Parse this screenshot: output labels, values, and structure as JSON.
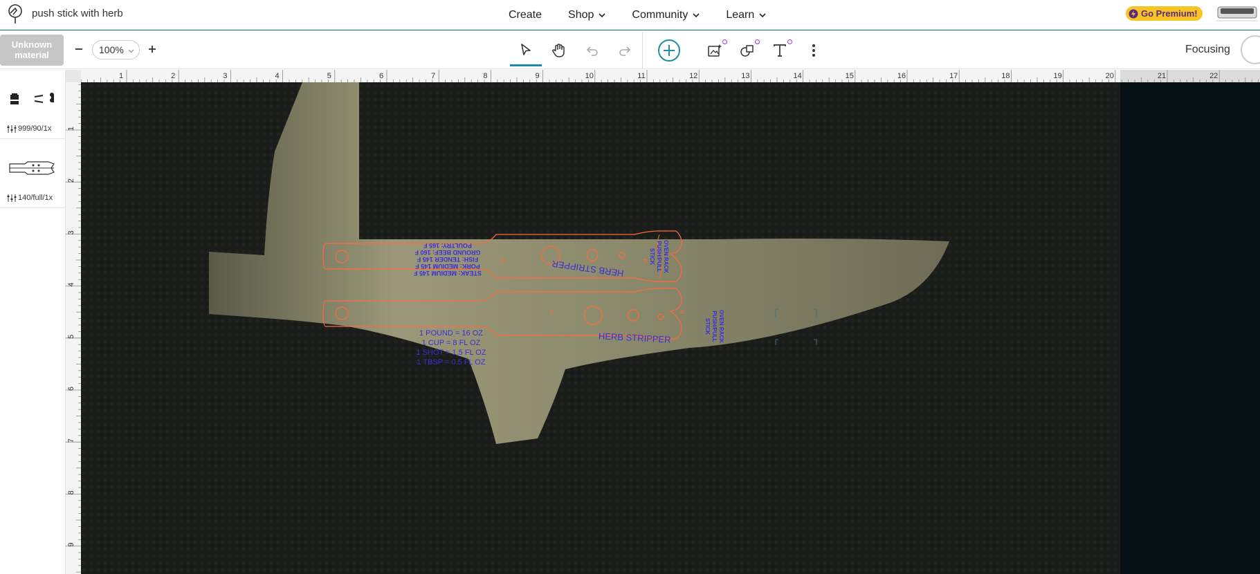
{
  "header": {
    "project_title": "push stick with herb",
    "nav": [
      {
        "label": "Create",
        "has_menu": false
      },
      {
        "label": "Shop",
        "has_menu": true
      },
      {
        "label": "Community",
        "has_menu": true
      },
      {
        "label": "Learn",
        "has_menu": true
      }
    ],
    "premium_label": "Go Premium!"
  },
  "toolbar": {
    "material_line1": "Unknown",
    "material_line2": "material",
    "zoom_value": "100%",
    "focus_label": "Focusing"
  },
  "layers": [
    {
      "settings": "999/90/1x"
    },
    {
      "settings": "140/full/1x"
    }
  ],
  "ruler": {
    "top_ticks": [
      "1",
      "2",
      "3",
      "4",
      "5",
      "6",
      "7",
      "8",
      "9",
      "10",
      "11",
      "12",
      "13",
      "14",
      "15",
      "16",
      "17",
      "18",
      "19",
      "20",
      "21",
      "22"
    ],
    "left_ticks": [
      "1",
      "2",
      "3",
      "4",
      "5",
      "6",
      "7",
      "8",
      "9"
    ]
  },
  "design": {
    "top_piece": {
      "engrave_lines": [
        "POULTRY: 165 F",
        "GROUND BEEF: 160 F",
        "FISH: TENDER 145 F",
        "PORK: MEDIUM 145 F",
        "STEAK: MEDIUM 145 F"
      ],
      "center_label": "HERB STRIPPER",
      "tip_line1": "OVEN RACK",
      "tip_line2": "PUSH/PULL",
      "tip_line3": "STICK"
    },
    "bottom_piece": {
      "engrave_lines": [
        "1 POUND = 16 OZ",
        "1 CUP = 8 FL OZ",
        "1 SHOT = 1.5 FL OZ",
        "1 TBSP = 0.5 FL OZ"
      ],
      "center_label": "HERB STRIPPER",
      "tip_line1": "OVEN RACK",
      "tip_line2": "PUSH/PULL",
      "tip_line3": "STICK"
    }
  },
  "colors": {
    "accent": "#1e8ca8",
    "cut_line": "#ff6a3d",
    "engrave_text": "#3b2fd6",
    "material": "#8f8f6f",
    "premium": "#f7c325"
  }
}
